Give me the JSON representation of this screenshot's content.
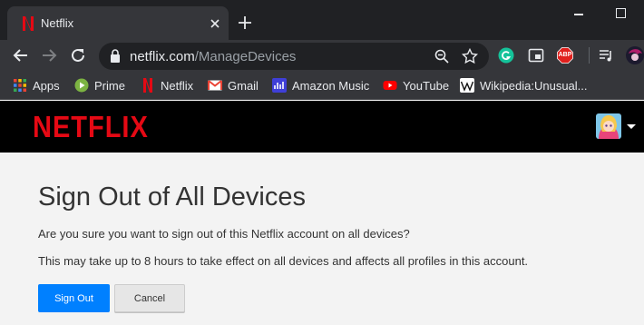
{
  "browser": {
    "tab": {
      "title": "Netflix"
    },
    "address": {
      "domain": "netflix.com",
      "path": "/ManageDevices"
    },
    "bookmarks": [
      {
        "label": "Apps",
        "icon": "apps-grid-icon"
      },
      {
        "label": "Prime",
        "icon": "prime-video-icon"
      },
      {
        "label": "Netflix",
        "icon": "netflix-icon"
      },
      {
        "label": "Gmail",
        "icon": "gmail-icon"
      },
      {
        "label": "Amazon Music",
        "icon": "amazon-music-icon"
      },
      {
        "label": "YouTube",
        "icon": "youtube-icon"
      },
      {
        "label": "Wikipedia:Unusual...",
        "icon": "wikipedia-icon"
      }
    ],
    "extensions": {
      "adblock_label": "ABP"
    }
  },
  "netflix": {
    "logo": "NETFLIX",
    "heading": "Sign Out of All Devices",
    "question": "Are you sure you want to sign out of this Netflix account on all devices?",
    "note": "This may take up to 8 hours to take effect on all devices and affects all profiles in this account.",
    "primary_button": "Sign Out",
    "secondary_button": "Cancel"
  },
  "colors": {
    "netflix_red": "#e50914",
    "primary_blue": "#0080ff",
    "chrome_dark": "#202124",
    "chrome_toolbar": "#35363a"
  }
}
